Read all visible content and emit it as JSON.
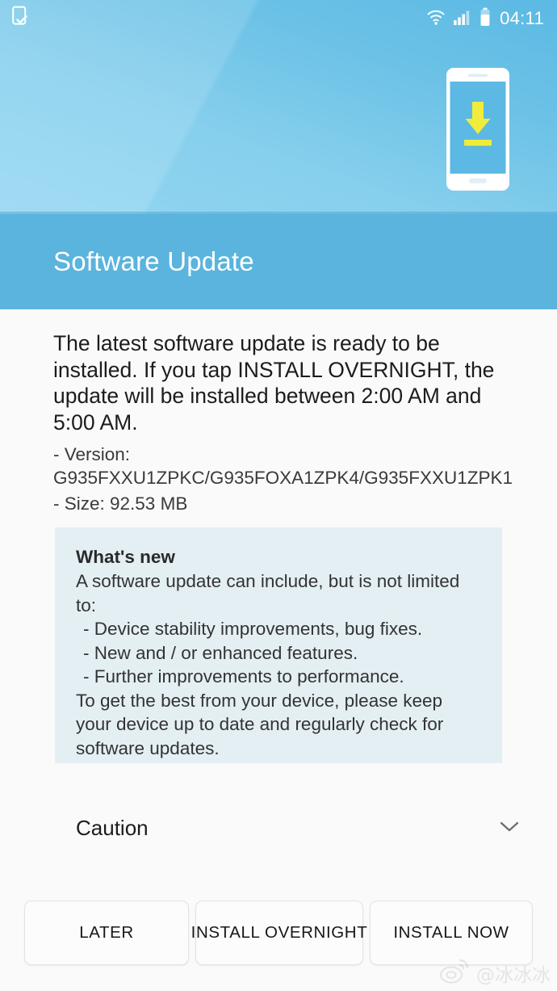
{
  "statusbar": {
    "left_icon": "software-update-check-icon",
    "icons": [
      "wifi-icon",
      "cellular-signal-icon",
      "battery-icon"
    ],
    "time": "04:11"
  },
  "hero": {
    "illustration": "phone-download-illustration",
    "background_gradient_from": "#5bb9e4",
    "background_gradient_to": "#93d6f1",
    "arrow_color": "#f0ec3c",
    "phone_frame_color": "#ffffff",
    "phone_screen_color": "#5cb9e3"
  },
  "edge_panel": {
    "handle": "edge-panel-handle"
  },
  "header": {
    "title": "Software Update",
    "background": "#5ab4dd",
    "text_color": "#ffffff"
  },
  "main": {
    "intro": "The latest software update is ready to be installed. If you tap INSTALL OVERNIGHT, the update will be installed between 2:00 AM and 5:00 AM.",
    "version_line": "- Version: G935FXXU1ZPKC/G935FOXA1ZPK4/G935FXXU1ZPK1",
    "size_line": "- Size: 92.53 MB",
    "version_label": "Version",
    "version_value": "G935FXXU1ZPKC/G935FOXA1ZPK4/G935FXXU1ZPK1",
    "size_label": "Size",
    "size_value": "92.53 MB"
  },
  "whats_new": {
    "title": "What's new",
    "intro": "A software update can include, but is not limited to:",
    "bullets": [
      "- Device stability improvements, bug fixes.",
      "- New and / or enhanced features.",
      "- Further improvements to performance."
    ],
    "outro": "To get the best from your device, please keep your device up to date and regularly check for software updates.",
    "background": "#e4eff4"
  },
  "caution": {
    "label": "Caution",
    "expander_icon": "chevron-down-icon",
    "expanded": false
  },
  "buttons": [
    {
      "id": "later",
      "label": "LATER"
    },
    {
      "id": "install-overnight",
      "label": "INSTALL OVERNIGHT"
    },
    {
      "id": "install-now",
      "label": "INSTALL NOW"
    }
  ],
  "watermark": {
    "icon": "weibo-logo-icon",
    "text": "@冰冰冰"
  }
}
